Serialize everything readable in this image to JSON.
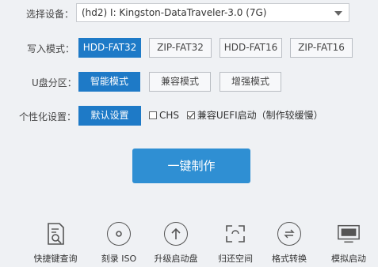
{
  "device": {
    "label": "选择设备：",
    "selected": "(hd2) I:  Kingston-DataTraveler-3.0 (7G)"
  },
  "write_mode": {
    "label": "写入模式：",
    "options": [
      "HDD-FAT32",
      "ZIP-FAT32",
      "HDD-FAT16",
      "ZIP-FAT16"
    ],
    "selected": "HDD-FAT32"
  },
  "partition": {
    "label": "U盘分区：",
    "options": [
      "智能模式",
      "兼容模式",
      "增强模式"
    ],
    "selected": "智能模式"
  },
  "personalize": {
    "label": "个性化设置：",
    "button": "默认设置",
    "chs_label": "CHS",
    "chs_checked": false,
    "uefi_label": "兼容UEFI启动（制作较缓慢）",
    "uefi_checked": true
  },
  "make_button": "一键制作",
  "toolbar": {
    "items": [
      {
        "icon": "shortcut-query-icon",
        "label": "快捷键查询"
      },
      {
        "icon": "burn-iso-icon",
        "label": "刻录 ISO"
      },
      {
        "icon": "upgrade-icon",
        "label": "升级启动盘"
      },
      {
        "icon": "restore-space-icon",
        "label": "归还空间"
      },
      {
        "icon": "format-convert-icon",
        "label": "格式转换"
      },
      {
        "icon": "simulate-boot-icon",
        "label": "模拟启动"
      }
    ]
  },
  "colors": {
    "accent": "#1e7ac7",
    "make_button": "#2f8fd3",
    "background": "#eff1f4"
  }
}
